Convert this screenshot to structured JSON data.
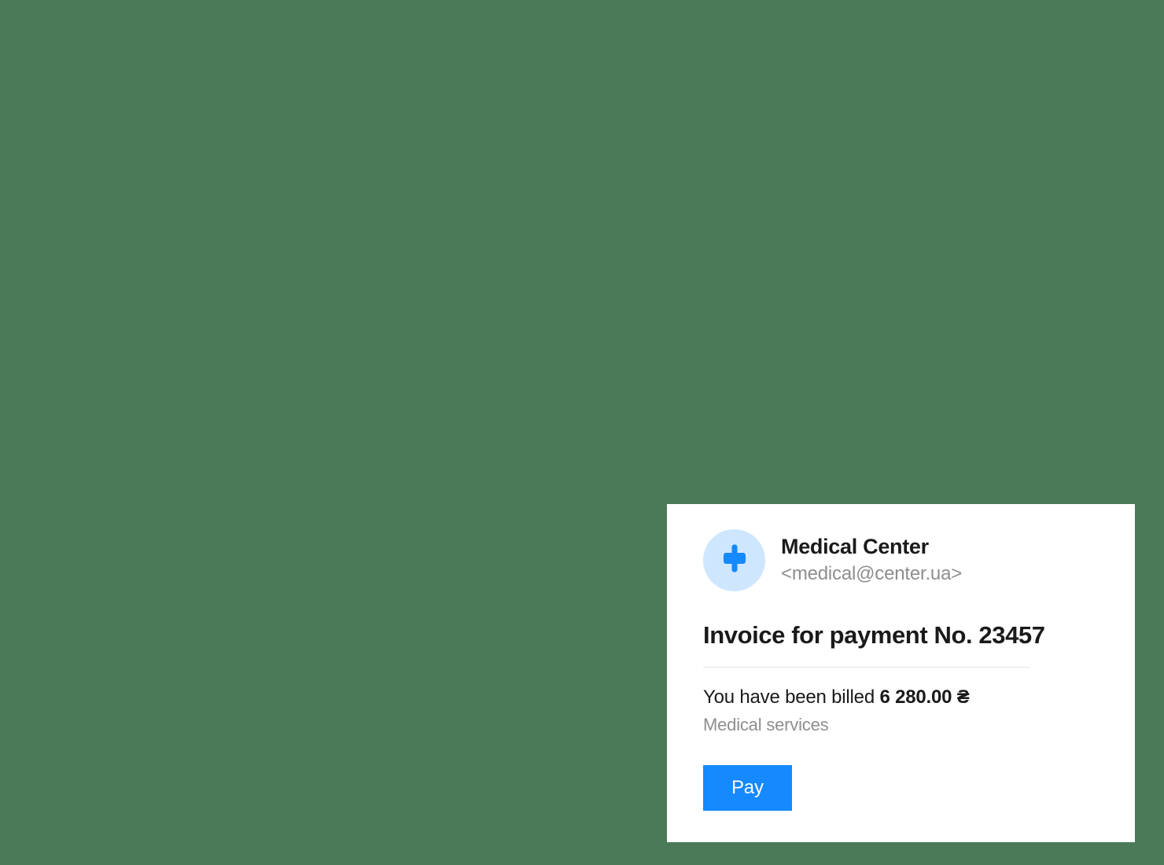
{
  "sender": {
    "name": "Medical Center",
    "email": "<medical@center.ua>",
    "icon": "medical-cross-icon"
  },
  "invoice": {
    "title": "Invoice for payment No. 23457",
    "billed_prefix": "You have been billed ",
    "amount": "6 280.00 ₴",
    "description": "Medical services"
  },
  "actions": {
    "pay_label": "Pay"
  },
  "colors": {
    "background": "#4a7a58",
    "card": "#ffffff",
    "accent": "#1589ff",
    "avatar_bg": "#cfe6ff",
    "text_primary": "#1a1a1a",
    "text_secondary": "#8e8e8e"
  }
}
